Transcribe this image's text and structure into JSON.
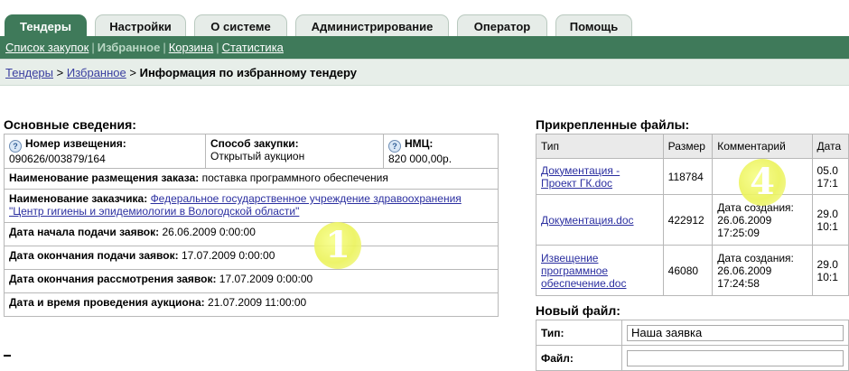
{
  "tabs": [
    {
      "label": "Тендеры",
      "active": true
    },
    {
      "label": "Настройки",
      "active": false
    },
    {
      "label": "О системе",
      "active": false
    },
    {
      "label": "Администрирование",
      "active": false
    },
    {
      "label": "Оператор",
      "active": false
    },
    {
      "label": "Помощь",
      "active": false
    }
  ],
  "subnav": {
    "items": [
      "Список закупок",
      "Избранное",
      "Корзина",
      "Статистика"
    ],
    "active": "Избранное"
  },
  "breadcrumb": {
    "link1": "Тендеры",
    "link2": "Избранное",
    "separator": ">",
    "current": "Информация по избранному тендеру"
  },
  "basic_info": {
    "title": "Основные сведения:",
    "notice_label": "Номер извещения:",
    "notice_value": "090626/003879/164",
    "method_label": "Способ закупки:",
    "method_value": "Открытый аукцион",
    "nmc_label": "НМЦ:",
    "nmc_value": "820 000,00р.",
    "order_label": "Наименование размещения заказа:",
    "order_value": "поставка программного обеспечения",
    "customer_label": "Наименование заказчика:",
    "customer_value": "Федеральное государственное учреждение здравоохранения \"Центр гигиены и эпидемиологии в Вологодской области\"",
    "start_label": "Дата начала подачи заявок:",
    "start_value": "26.06.2009 0:00:00",
    "end_label": "Дата окончания подачи заявок:",
    "end_value": "17.07.2009 0:00:00",
    "review_label": "Дата окончания рассмотрения заявок:",
    "review_value": "17.07.2009 0:00:00",
    "auction_label": "Дата и время проведения аукциона:",
    "auction_value": "21.07.2009 11:00:00"
  },
  "files": {
    "title": "Прикрепленные файлы:",
    "headers": [
      "Тип",
      "Размер",
      "Комментарий",
      "Дата"
    ],
    "rows": [
      {
        "type": "Документация - Проект ГК.doc",
        "size": "118784",
        "comment": "",
        "date": "05.0\n17:1"
      },
      {
        "type": "Документация.doc",
        "size": "422912",
        "comment": "Дата создания:\n26.06.2009\n17:25:09",
        "date": "29.0\n10:1"
      },
      {
        "type": "Извещение программное обеспечение.doc",
        "size": "46080",
        "comment": "Дата создания:\n26.06.2009\n17:24:58",
        "date": "29.0\n10:1"
      }
    ]
  },
  "new_file": {
    "title": "Новый файл:",
    "type_label": "Тип:",
    "type_value": "Наша заявка",
    "file_label": "Файл:"
  },
  "badges": {
    "one": "1",
    "four": "4"
  },
  "colors": {
    "accent": "#3f7a5a",
    "breadcrumb_bg": "#e7eee9",
    "link": "#2b2fa0",
    "badge": "#ecf35a"
  }
}
